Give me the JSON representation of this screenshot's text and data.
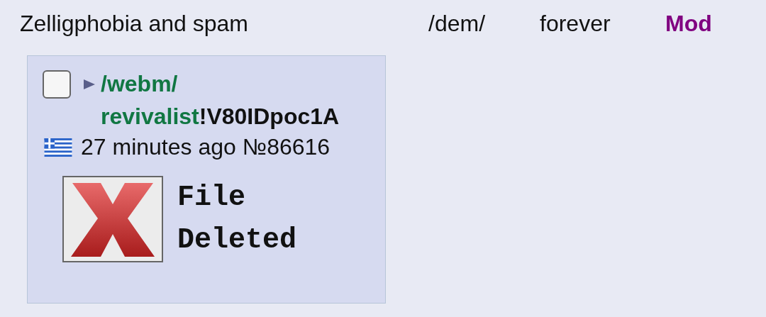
{
  "header": {
    "subject": "Zelligphobia and spam",
    "board": "/dem/",
    "expiry": "forever",
    "role": "Mod"
  },
  "post": {
    "checked": false,
    "name": "/webm/ revivalist",
    "tripcode": "!V80IDpoc1A",
    "time": "27 minutes ago",
    "number": "№86616",
    "file": {
      "label": "File Deleted"
    }
  }
}
